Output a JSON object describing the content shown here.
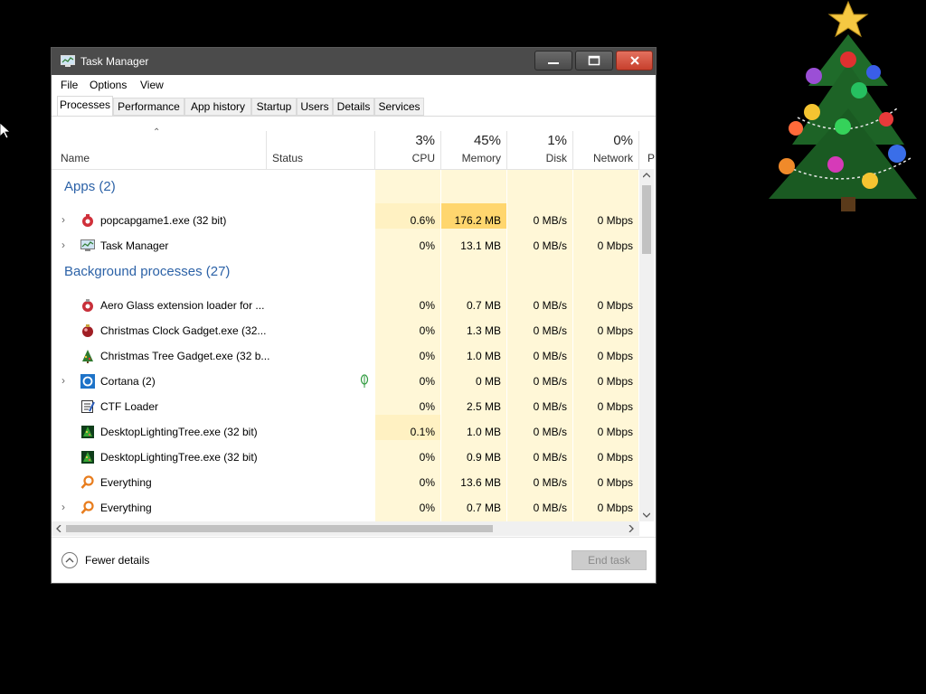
{
  "window": {
    "title": "Task Manager"
  },
  "menu": [
    "File",
    "Options",
    "View"
  ],
  "tabs": [
    "Processes",
    "Performance",
    "App history",
    "Startup",
    "Users",
    "Details",
    "Services"
  ],
  "active_tab": "Processes",
  "columns": {
    "name": "Name",
    "status": "Status",
    "cpu": {
      "pct": "3%",
      "label": "CPU"
    },
    "memory": {
      "pct": "45%",
      "label": "Memory"
    },
    "disk": {
      "pct": "1%",
      "label": "Disk"
    },
    "network": {
      "pct": "0%",
      "label": "Network"
    },
    "power": "P"
  },
  "groups": {
    "apps": "Apps (2)",
    "background": "Background processes (27)"
  },
  "rows": [
    {
      "name": "popcapgame1.exe (32 bit)",
      "cpu": "0.6%",
      "memory": "176.2 MB",
      "disk": "0 MB/s",
      "network": "0 Mbps",
      "icon": "popcap-icon",
      "expandable": true
    },
    {
      "name": "Task Manager",
      "cpu": "0%",
      "memory": "13.1 MB",
      "disk": "0 MB/s",
      "network": "0 Mbps",
      "icon": "task-manager-icon",
      "expandable": true
    },
    {
      "name": "Aero Glass extension loader for ...",
      "cpu": "0%",
      "memory": "0.7 MB",
      "disk": "0 MB/s",
      "network": "0 Mbps",
      "icon": "ornament-icon",
      "expandable": false
    },
    {
      "name": "Christmas Clock Gadget.exe (32...",
      "cpu": "0%",
      "memory": "1.3 MB",
      "disk": "0 MB/s",
      "network": "0 Mbps",
      "icon": "christmas-clock-icon",
      "expandable": false
    },
    {
      "name": "Christmas Tree Gadget.exe (32 b...",
      "cpu": "0%",
      "memory": "1.0 MB",
      "disk": "0 MB/s",
      "network": "0 Mbps",
      "icon": "christmas-tree-icon",
      "expandable": false
    },
    {
      "name": "Cortana (2)",
      "cpu": "0%",
      "memory": "0 MB",
      "disk": "0 MB/s",
      "network": "0 Mbps",
      "icon": "cortana-icon",
      "expandable": true,
      "status_icon": "leaf-icon"
    },
    {
      "name": "CTF Loader",
      "cpu": "0%",
      "memory": "2.5 MB",
      "disk": "0 MB/s",
      "network": "0 Mbps",
      "icon": "ctf-loader-icon",
      "expandable": false
    },
    {
      "name": "DesktopLightingTree.exe (32 bit)",
      "cpu": "0.1%",
      "memory": "1.0 MB",
      "disk": "0 MB/s",
      "network": "0 Mbps",
      "icon": "lighting-tree-icon",
      "expandable": false
    },
    {
      "name": "DesktopLightingTree.exe (32 bit)",
      "cpu": "0%",
      "memory": "0.9 MB",
      "disk": "0 MB/s",
      "network": "0 Mbps",
      "icon": "lighting-tree-icon",
      "expandable": false
    },
    {
      "name": "Everything",
      "cpu": "0%",
      "memory": "13.6 MB",
      "disk": "0 MB/s",
      "network": "0 Mbps",
      "icon": "everything-search-icon",
      "expandable": false
    },
    {
      "name": "Everything",
      "cpu": "0%",
      "memory": "0.7 MB",
      "disk": "0 MB/s",
      "network": "0 Mbps",
      "icon": "everything-search-icon",
      "expandable": true
    }
  ],
  "footer": {
    "fewer_details": "Fewer details",
    "end_task": "End task"
  },
  "colors": {
    "heat_light": "#fff7d7",
    "heat_mid": "#fff1c2",
    "heat_high": "#ffd66e",
    "group_blue": "#2c62a7",
    "titlebar": "#4b4b4b"
  }
}
